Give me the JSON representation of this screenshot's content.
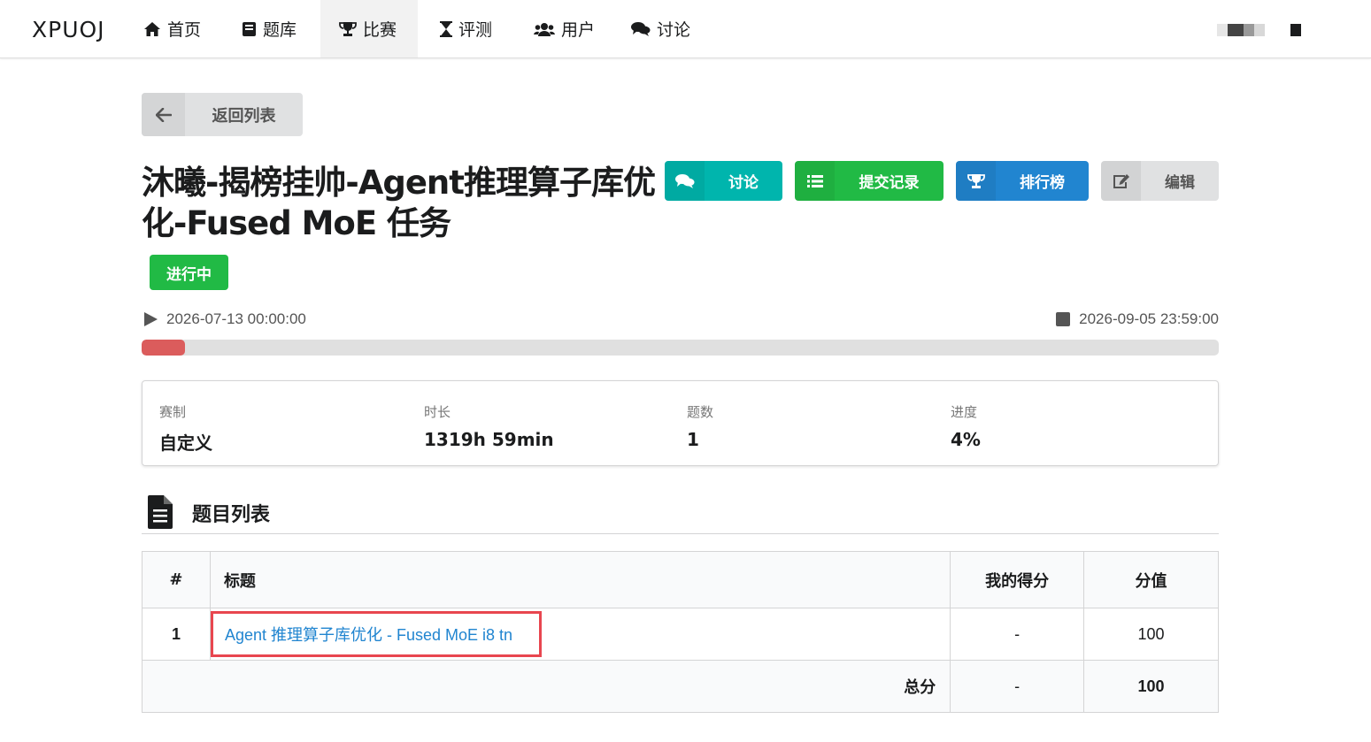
{
  "nav": {
    "brand": "XPUOJ",
    "items": [
      {
        "label": "首页",
        "icon": "home-icon"
      },
      {
        "label": "题库",
        "icon": "book-icon"
      },
      {
        "label": "比赛",
        "icon": "trophy-icon"
      },
      {
        "label": "评测",
        "icon": "hourglass-icon"
      },
      {
        "label": "用户",
        "icon": "users-icon"
      },
      {
        "label": "讨论",
        "icon": "comments-icon"
      }
    ]
  },
  "back_label": "返回列表",
  "contest": {
    "title": "沐曦-揭榜挂帅-Agent推理算子库优化-Fused MoE 任务",
    "status": "进行中",
    "start": "2026-07-13 00:00:00",
    "end": "2026-09-05 23:59:00",
    "progress_fraction": 0.04
  },
  "actions": {
    "discuss": "讨论",
    "submissions": "提交记录",
    "ranklist": "排行榜",
    "edit": "编辑"
  },
  "stats": [
    {
      "key": "赛制",
      "value": "自定义"
    },
    {
      "key": "时长",
      "value": "1319h 59min"
    },
    {
      "key": "题数",
      "value": "1"
    },
    {
      "key": "进度",
      "value": "4%"
    }
  ],
  "problems": {
    "section_title": "题目列表",
    "headers": [
      "#",
      "标题",
      "我的得分",
      "分值"
    ],
    "rows": [
      {
        "num": "1",
        "title": "Agent 推理算子库优化 - Fused MoE i8 tn",
        "score": "-",
        "points": "100"
      }
    ],
    "total": {
      "label": "总分",
      "score": "-",
      "points": "100"
    }
  },
  "colors": {
    "green": "#21ba45",
    "teal": "#00b5ad",
    "blue": "#2185d0",
    "progress_red": "#db5c5c",
    "highlight_red": "#e8464f"
  }
}
